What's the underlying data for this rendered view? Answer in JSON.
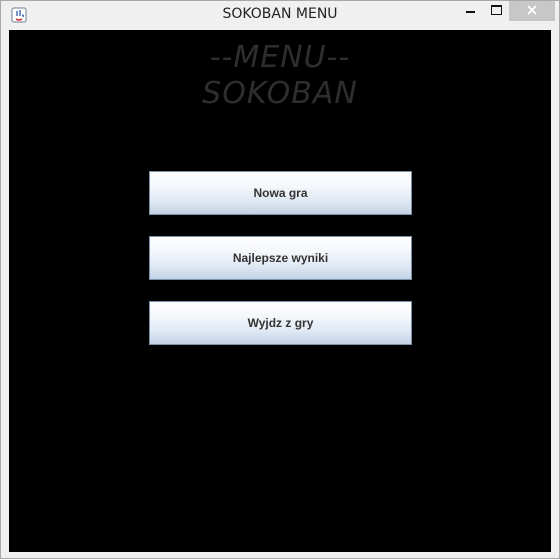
{
  "window": {
    "title": "SOKOBAN MENU",
    "close_button_color": "#c7c7c7"
  },
  "menu": {
    "title_line1": "--MENU--",
    "title_line2": "SOKOBAN",
    "title_color": "#2e2e2e",
    "background_color": "#000000",
    "buttons": [
      {
        "label": "Nowa gra"
      },
      {
        "label": "Najlepsze wyniki"
      },
      {
        "label": "Wyjdz z gry"
      }
    ]
  },
  "icons": {
    "app": "java-app-icon",
    "minimize": "minimize-icon",
    "maximize": "maximize-icon",
    "close": "close-icon"
  }
}
